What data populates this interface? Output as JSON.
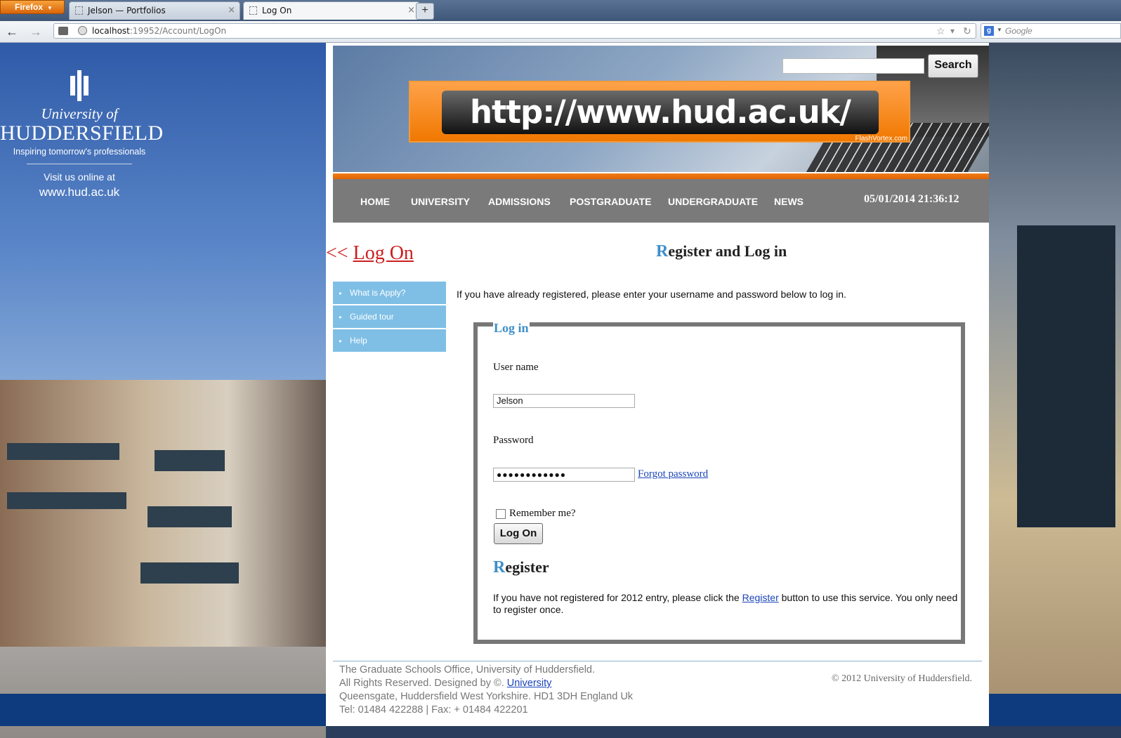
{
  "browser": {
    "menu_button": "Firefox",
    "tabs": [
      {
        "label": "Jelson — Portfolios",
        "close": "×"
      },
      {
        "label": "Log On",
        "close": "×"
      }
    ],
    "new_tab": "+",
    "back": "←",
    "forward": "→",
    "url_host": "localhost",
    "url_rest": ":19952/Account/LogOn",
    "bookmark_star": "☆",
    "dropdown": "▾",
    "reload": "↻",
    "search_engine_icon": "g",
    "search_placeholder": "Google"
  },
  "brand": {
    "university_of": "University of",
    "name": "HUDDERSFIELD",
    "tagline": "Inspiring tomorrow's professionals",
    "visit_text": "Visit us online at",
    "website": "www.hud.ac.uk"
  },
  "header": {
    "search_button": "Search",
    "banner_url": "http://www.hud.ac.uk/",
    "banner_credit": "FlashVortex.com"
  },
  "nav": {
    "items": [
      "HOME",
      "UNIVERSITY",
      "ADMISSIONS",
      "POSTGRADUATE",
      "UNDERGRADUATE",
      "NEWS"
    ],
    "datetime": "05/01/2014 21:36:12"
  },
  "page": {
    "back_arrows": "<<",
    "back_label": "Log On",
    "heading_first": "R",
    "heading_rest": "egister and Log in"
  },
  "sidemenu": {
    "arrow": "▸",
    "items": [
      "What is Apply?",
      "Guided tour",
      "Help"
    ]
  },
  "intro": "If you have already registered, please enter your username and password below to log in.",
  "login": {
    "legend": "Log in",
    "username_label": "User name",
    "username_value": "Jelson",
    "password_label": "Password",
    "password_value": "●●●●●●●●●●●●",
    "forgot": "Forgot password",
    "remember": "Remember me?",
    "submit": "Log On"
  },
  "register": {
    "title_first": "R",
    "title_rest": "egister",
    "text_before": "If you have not registered for 2012 entry, please click the ",
    "link": "Register",
    "text_after": " button to use this service. You only need to register once."
  },
  "footer": {
    "line1": "The Graduate Schools Office, University of Huddersfield.",
    "line2_prefix": "All Rights Reserved. Designed by ©. ",
    "line2_link": "University",
    "line3": "Queensgate, Huddersfield West Yorkshire. HD1 3DH England Uk",
    "line4": "Tel: 01484 422288 | Fax: + 01484 422201",
    "copyright": "© 2012 University of Huddersfield."
  }
}
